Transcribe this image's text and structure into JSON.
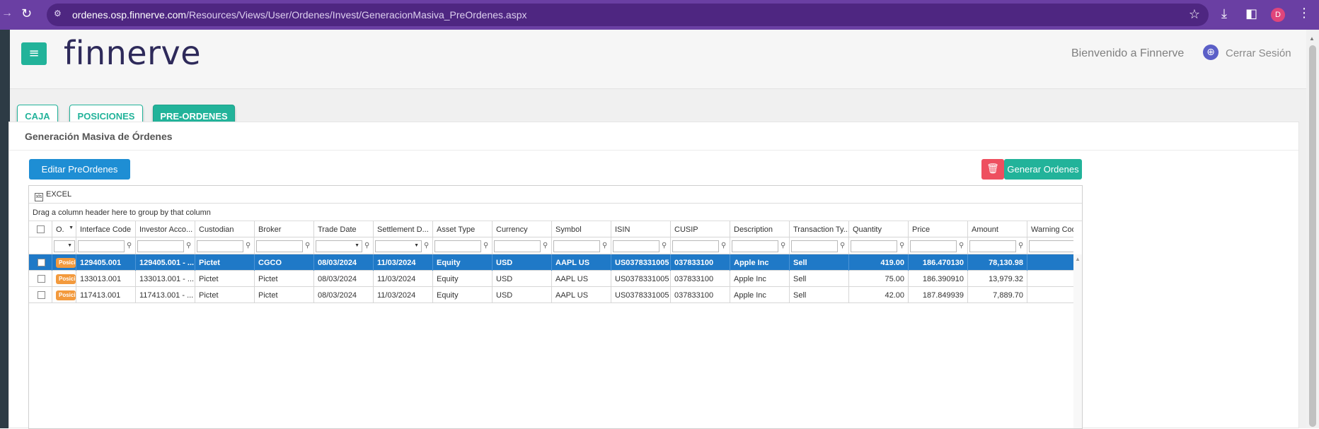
{
  "browser": {
    "url_host": "ordenes.osp.finnerve.com",
    "url_path": "/Resources/Views/User/Ordenes/Invest/GeneracionMasiva_PreOrdenes.aspx",
    "profile_initial": "D"
  },
  "header": {
    "logo": "finnerve",
    "welcome": "Bienvenido a Finnerve",
    "logout": "Cerrar Sesión"
  },
  "tabs": [
    {
      "label": "CAJA"
    },
    {
      "label": "POSICIONES"
    },
    {
      "label": "PRE-ORDENES"
    }
  ],
  "panel": {
    "title": "Generación Masiva de Órdenes",
    "edit_button": "Editar PreOrdenes",
    "generate_button": "Generar Ordenes"
  },
  "grid": {
    "toolbar_excel": "EXCEL",
    "group_hint": "Drag a column header here to group by that column",
    "columns": [
      "O.",
      "Interface Code",
      "Investor Acco...",
      "Custodian",
      "Broker",
      "Trade Date",
      "Settlement D...",
      "Asset Type",
      "Currency",
      "Symbol",
      "ISIN",
      "CUSIP",
      "Description",
      "Transaction Ty...",
      "Quantity",
      "Price",
      "Amount",
      "Warning Cod"
    ],
    "rows": [
      {
        "badge": "Posicio",
        "interface_code": "129405.001",
        "investor_account": "129405.001 - ...",
        "custodian": "Pictet",
        "broker": "CGCO",
        "trade_date": "08/03/2024",
        "settlement_date": "11/03/2024",
        "asset_type": "Equity",
        "currency": "USD",
        "symbol": "AAPL US",
        "isin": "US0378331005",
        "cusip": "037833100",
        "description": "Apple Inc",
        "transaction_type": "Sell",
        "quantity": "419.00",
        "price": "186.470130",
        "amount": "78,130.98",
        "warning_code": ""
      },
      {
        "badge": "Posicio",
        "interface_code": "133013.001",
        "investor_account": "133013.001 - ...",
        "custodian": "Pictet",
        "broker": "Pictet",
        "trade_date": "08/03/2024",
        "settlement_date": "11/03/2024",
        "asset_type": "Equity",
        "currency": "USD",
        "symbol": "AAPL US",
        "isin": "US0378331005",
        "cusip": "037833100",
        "description": "Apple Inc",
        "transaction_type": "Sell",
        "quantity": "75.00",
        "price": "186.390910",
        "amount": "13,979.32",
        "warning_code": ""
      },
      {
        "badge": "Posicio",
        "interface_code": "117413.001",
        "investor_account": "117413.001 - ...",
        "custodian": "Pictet",
        "broker": "Pictet",
        "trade_date": "08/03/2024",
        "settlement_date": "11/03/2024",
        "asset_type": "Equity",
        "currency": "USD",
        "symbol": "AAPL US",
        "isin": "US0378331005",
        "cusip": "037833100",
        "description": "Apple Inc",
        "transaction_type": "Sell",
        "quantity": "42.00",
        "price": "187.849939",
        "amount": "7,889.70",
        "warning_code": ""
      }
    ]
  }
}
